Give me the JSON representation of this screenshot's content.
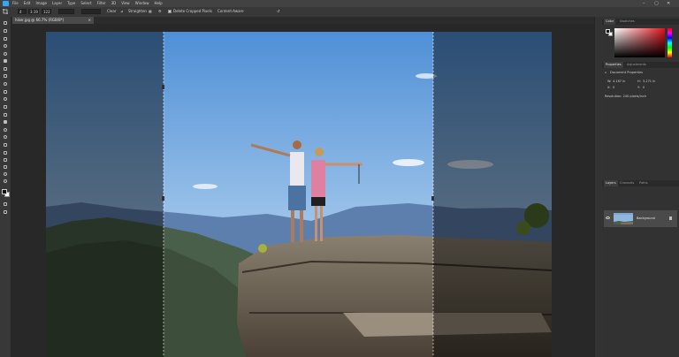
{
  "menubar": {
    "items": [
      "File",
      "Edit",
      "Image",
      "Layer",
      "Type",
      "Select",
      "Filter",
      "3D",
      "View",
      "Window",
      "Help"
    ],
    "controls": [
      "–",
      "▢",
      "✕"
    ]
  },
  "options": {
    "ratio_1": "4",
    "ratio_2": "3.19",
    "ratio_3": "122",
    "clear": "Clear",
    "straighten": "Straighten",
    "delete_cropped": "Delete Cropped Pixels",
    "content_aware": "Content-Aware"
  },
  "document": {
    "tab_title": "hiker.jpg @ 66.7% (RGB/8*)",
    "close": "×"
  },
  "toolbar": {
    "tools": [
      "move-tool-icon",
      "artboard-tool-icon",
      "marquee-tool-icon",
      "lasso-tool-icon",
      "quick-select-tool-icon",
      "crop-tool-icon",
      "frame-tool-icon",
      "eyedropper-tool-icon",
      "healing-brush-icon",
      "brush-tool-icon",
      "clone-stamp-icon",
      "history-brush-icon",
      "eraser-tool-icon",
      "gradient-tool-icon",
      "blur-tool-icon",
      "dodge-tool-icon",
      "pen-tool-icon",
      "type-tool-icon",
      "path-select-icon",
      "shape-tool-icon",
      "hand-tool-icon",
      "zoom-tool-icon",
      "more-tools-icon"
    ]
  },
  "panels": {
    "color_tabs": [
      "Color",
      "Swatches"
    ],
    "props_tabs": [
      "Properties",
      "Adjustments"
    ],
    "doc_props": "Document Properties",
    "w_label": "W:",
    "w_value": "4.167 in",
    "h_label": "H:",
    "h_value": "3.271 in",
    "x_label": "X:",
    "x_value": "0",
    "y_label": "Y:",
    "y_value": "0",
    "resolution": "Resolution: 240 pixels/inch",
    "layers_tabs": [
      "Layers",
      "Channels",
      "Paths"
    ],
    "layer_name": "Background"
  },
  "colors": {
    "accent": "#31a8ff",
    "canvas": "#282828",
    "panel": "#323232"
  }
}
